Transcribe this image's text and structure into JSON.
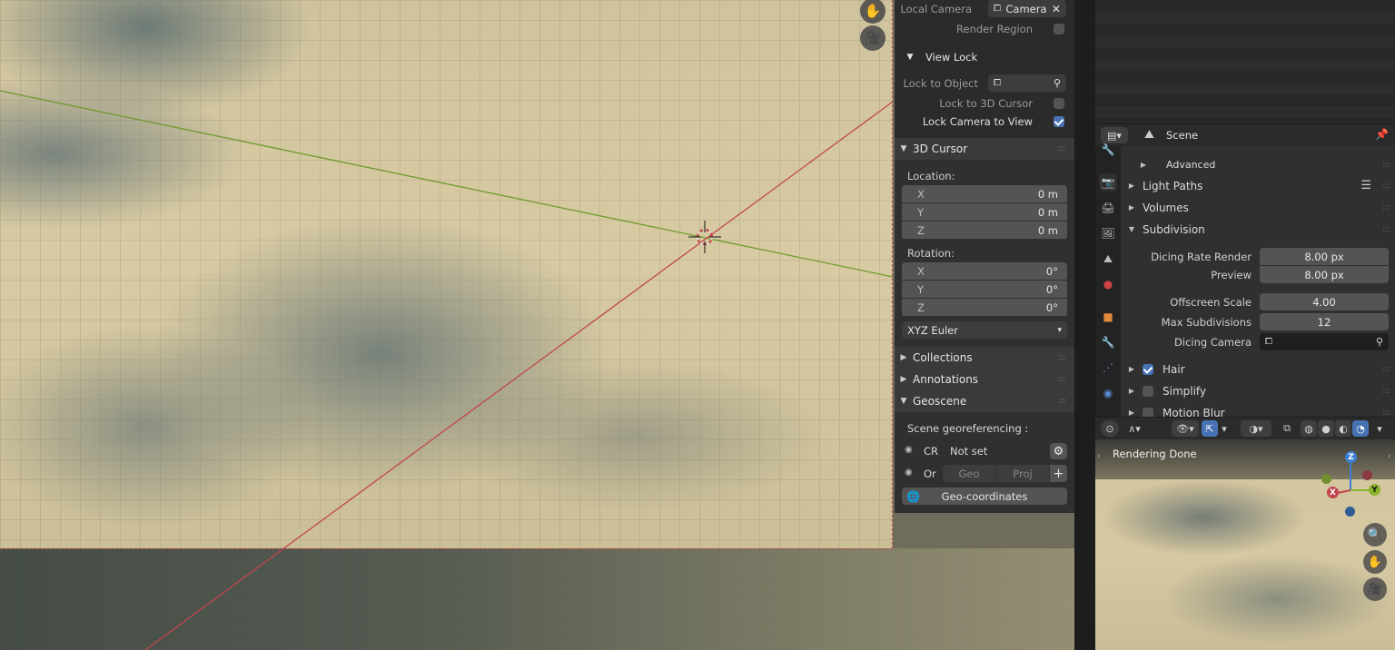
{
  "npanel": {
    "local_camera_label": "Local Camera",
    "local_camera_value": "Camera",
    "render_region_label": "Render Region",
    "view_lock_header": "View Lock",
    "lock_to_object_label": "Lock to Object",
    "lock_to_3d_cursor_label": "Lock to 3D Cursor",
    "lock_camera_to_view_label": "Lock Camera to View",
    "cursor_header": "3D Cursor",
    "location_label": "Location:",
    "location": [
      {
        "axis": "X",
        "value": "0 m"
      },
      {
        "axis": "Y",
        "value": "0 m"
      },
      {
        "axis": "Z",
        "value": "0 m"
      }
    ],
    "rotation_label": "Rotation:",
    "rotation": [
      {
        "axis": "X",
        "value": "0°"
      },
      {
        "axis": "Y",
        "value": "0°"
      },
      {
        "axis": "Z",
        "value": "0°"
      }
    ],
    "rotation_mode": "XYZ Euler",
    "collections_header": "Collections",
    "annotations_header": "Annotations",
    "geoscene_header": "Geoscene",
    "scene_georef_label": "Scene georeferencing :",
    "crs_label": "CR",
    "crs_value": "Not set",
    "origin_label": "Or",
    "geo_button": "Geo",
    "proj_button": "Proj",
    "add_button": "+",
    "geo_coordinates_button": "Geo-coordinates"
  },
  "properties": {
    "scene_name": "Scene",
    "advanced_label": "Advanced",
    "sections": {
      "light_paths": "Light Paths",
      "volumes": "Volumes",
      "subdivision": "Subdivision",
      "hair": "Hair",
      "simplify": "Simplify",
      "motion_blur": "Motion Blur"
    },
    "subdivision_fields": {
      "dicing_rate_render_label": "Dicing Rate Render",
      "dicing_rate_render_value": "8.00 px",
      "preview_label": "Preview",
      "preview_value": "8.00 px",
      "offscreen_scale_label": "Offscreen Scale",
      "offscreen_scale_value": "4.00",
      "max_subdivisions_label": "Max Subdivisions",
      "max_subdivisions_value": "12",
      "dicing_camera_label": "Dicing Camera"
    }
  },
  "mini_viewport": {
    "status_text": "Rendering Done",
    "gizmo_labels": {
      "z": "Z",
      "y": "Y",
      "x": "X"
    }
  },
  "colors": {
    "accent_blue": "#4772b3",
    "x_axis": "#c0464e",
    "y_axis": "#6e9a2e",
    "panel_bg": "#2b2b2b"
  }
}
